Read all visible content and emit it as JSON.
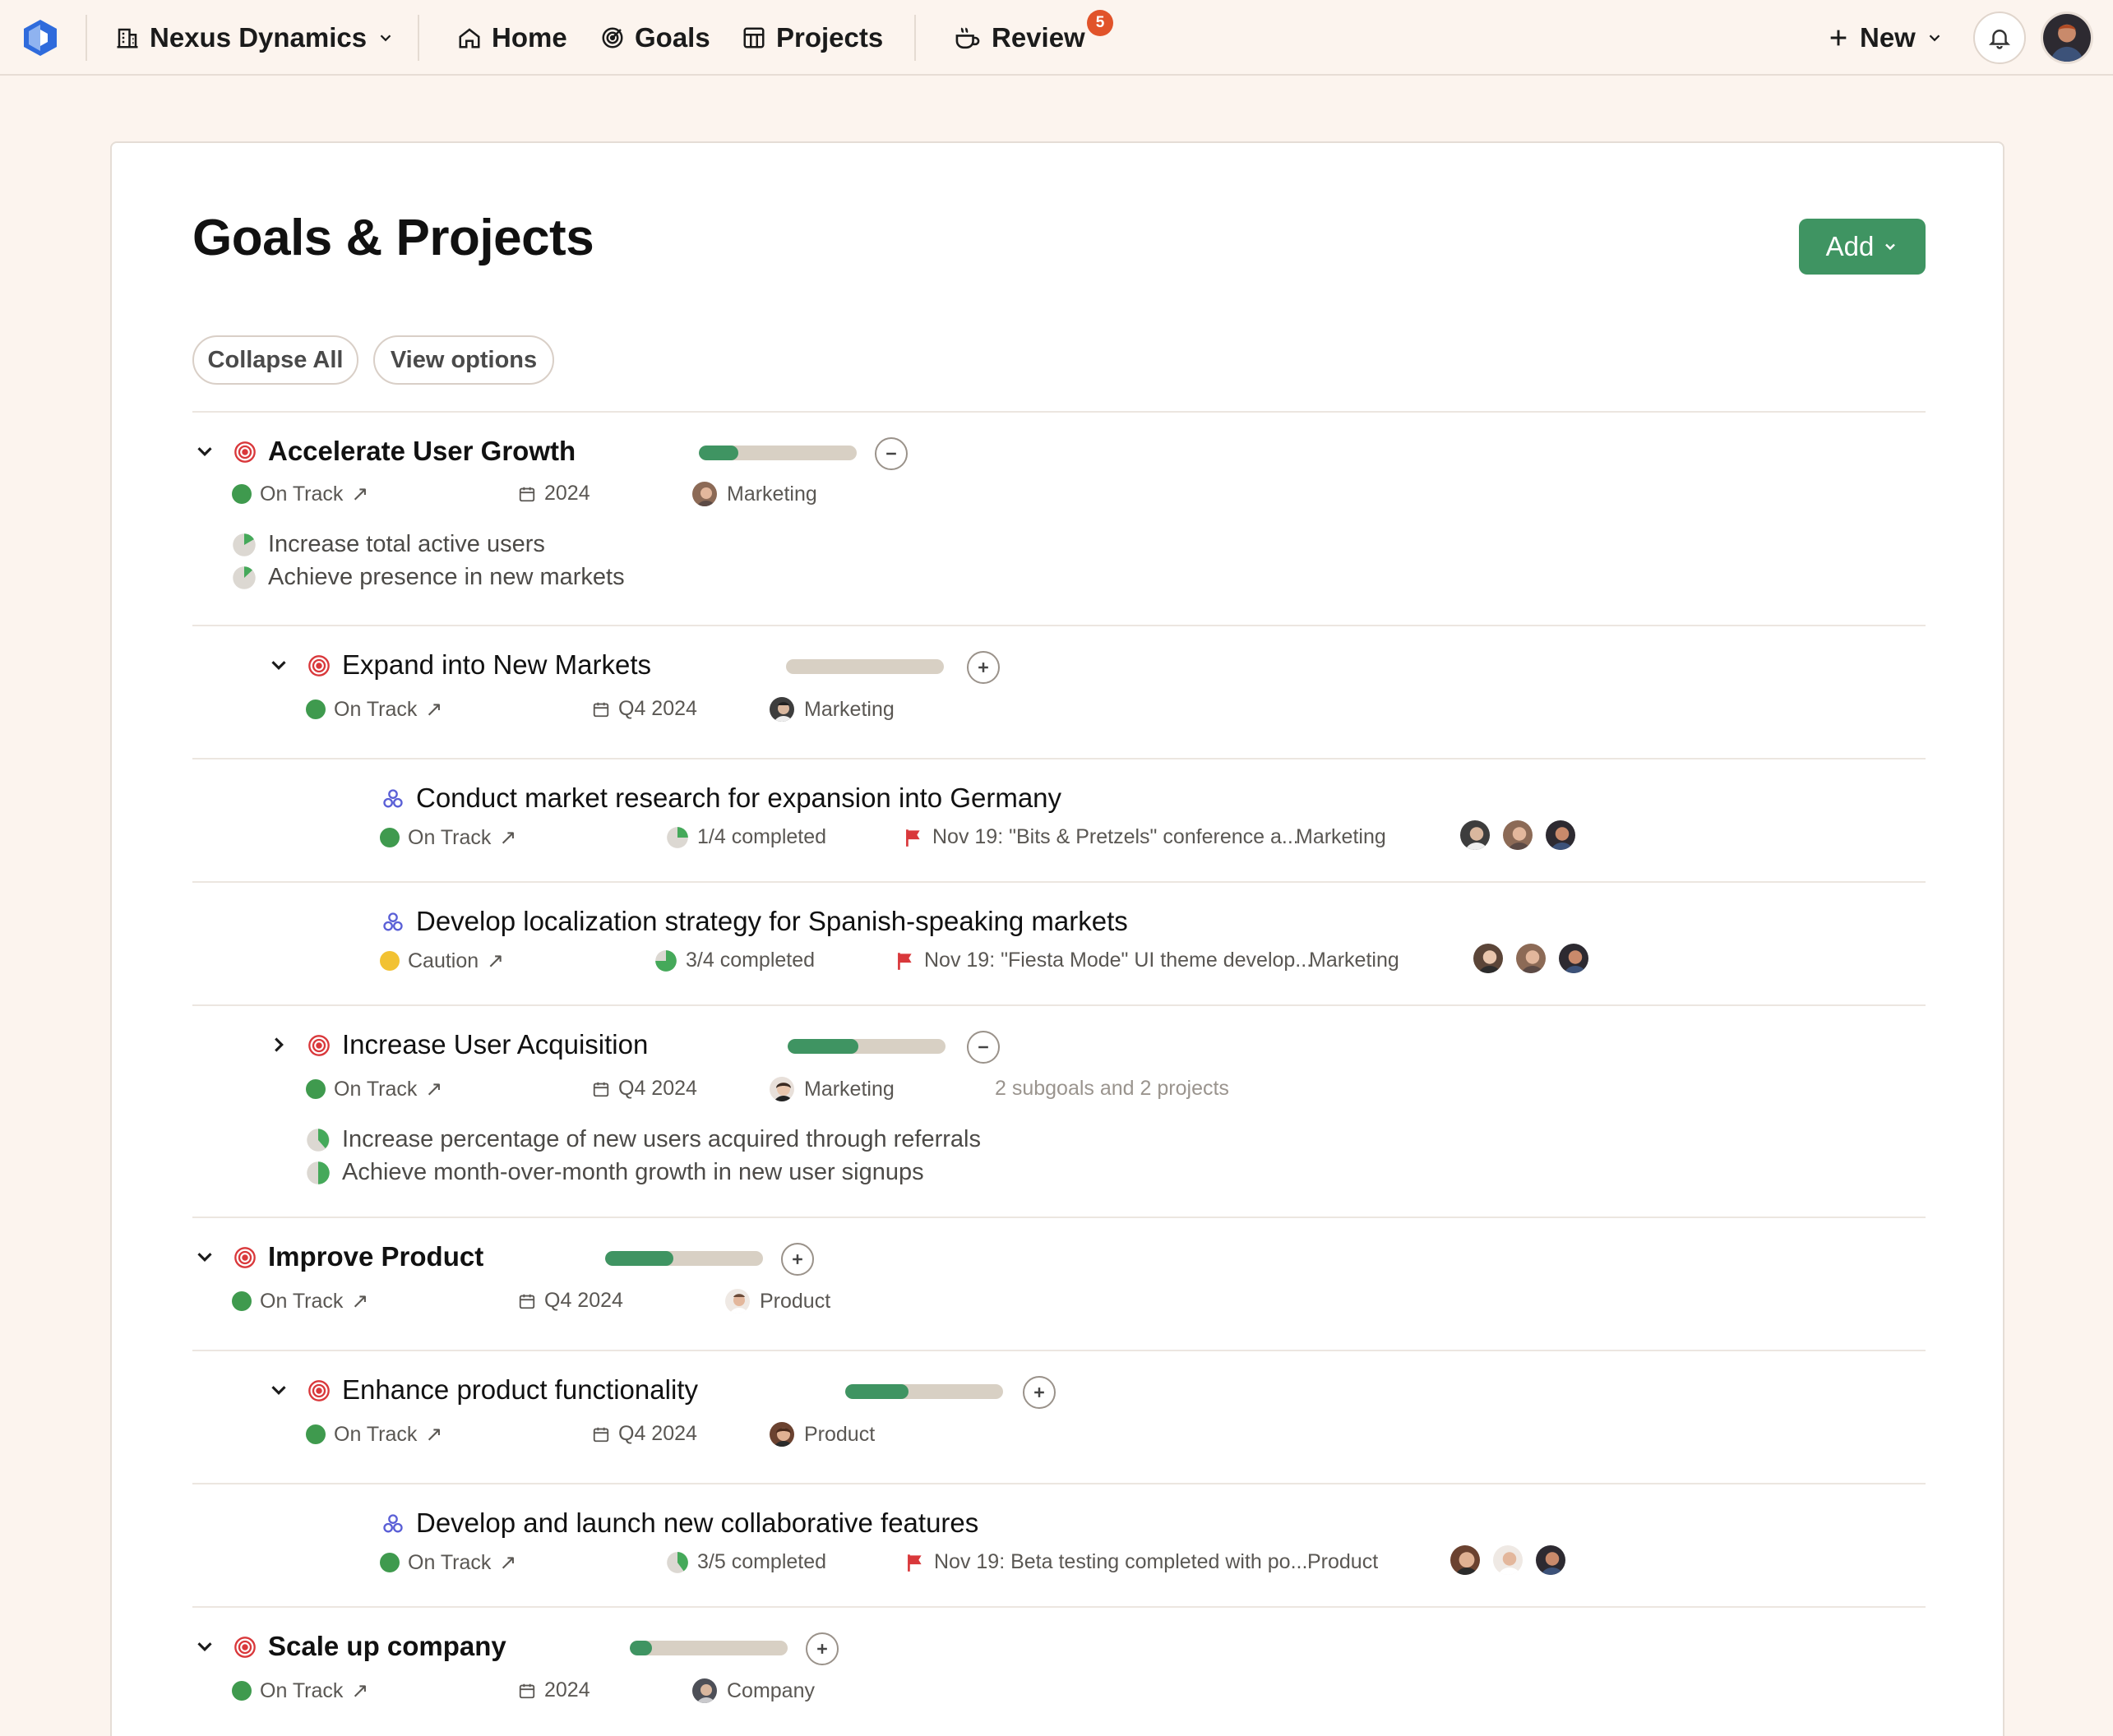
{
  "topbar": {
    "org": "Nexus Dynamics",
    "nav": [
      {
        "label": "Home",
        "icon": "home-icon"
      },
      {
        "label": "Goals",
        "icon": "goal-target-icon"
      },
      {
        "label": "Projects",
        "icon": "projects-grid-icon"
      }
    ],
    "review": {
      "label": "Review",
      "badge": "5"
    },
    "new_label": "New"
  },
  "page": {
    "title": "Goals & Projects",
    "add_label": "Add",
    "collapse_all": "Collapse All",
    "view_options": "View options"
  },
  "rows": {
    "g1": {
      "title": "Accelerate User Growth",
      "progress": 0.25,
      "status": "On Track",
      "period": "2024",
      "team": "Marketing",
      "targets": [
        "Increase total active users",
        "Achieve presence in new markets"
      ]
    },
    "g1a": {
      "title": "Expand into New Markets",
      "progress": 0.0,
      "status": "On Track",
      "period": "Q4 2024",
      "team": "Marketing"
    },
    "p1": {
      "title": "Conduct market research for expansion into Germany",
      "status": "On Track",
      "completed": "1/4 completed",
      "milestone": "Nov 19: \"Bits & Pretzels\" conference a...",
      "team": "Marketing"
    },
    "p2": {
      "title": "Develop localization strategy for Spanish-speaking markets",
      "status": "Caution",
      "completed": "3/4 completed",
      "milestone": "Nov 19: \"Fiesta Mode\" UI theme develop...",
      "team": "Marketing"
    },
    "g1b": {
      "title": "Increase User Acquisition",
      "progress": 0.45,
      "status": "On Track",
      "period": "Q4 2024",
      "team": "Marketing",
      "summary": "2 subgoals and 2 projects",
      "targets": [
        "Increase percentage of new users acquired through referrals",
        "Achieve month-over-month growth in new user signups"
      ]
    },
    "g2": {
      "title": "Improve Product",
      "progress": 0.43,
      "status": "On Track",
      "period": "Q4 2024",
      "team": "Product"
    },
    "g2a": {
      "title": "Enhance product functionality",
      "progress": 0.4,
      "status": "On Track",
      "period": "Q4 2024",
      "team": "Product"
    },
    "p3": {
      "title": "Develop and launch new collaborative features",
      "status": "On Track",
      "completed": "3/5 completed",
      "milestone": "Nov 19: Beta testing completed with po...",
      "team": "Product"
    },
    "g3": {
      "title": "Scale up company",
      "progress": 0.14,
      "status": "On Track",
      "period": "2024",
      "team": "Company"
    }
  },
  "colors": {
    "accent_green": "#3f9462",
    "status_on_track": "#3f9a4e",
    "status_caution": "#f2c233",
    "badge": "#e1532a",
    "goal_icon": "#d9383b",
    "project_icon": "#5a5fd6",
    "milestone_flag": "#d9383b"
  }
}
